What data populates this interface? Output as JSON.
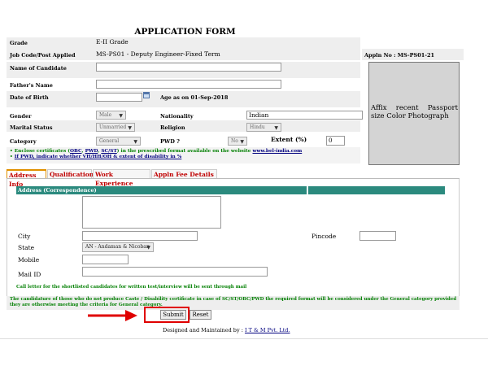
{
  "title": "APPLICATION FORM",
  "grade": {
    "label": "Grade",
    "value": "E-II Grade"
  },
  "job": {
    "label": "Job Code/Post Applied",
    "value": "MS-PS01 - Deputy Engineer-Fixed Term"
  },
  "appln_no": "Appln No : MS-PS01-21",
  "name": {
    "label": "Name of Candidate",
    "value": ""
  },
  "father": {
    "label": "Father's Name",
    "value": ""
  },
  "dob": {
    "label": "Date of Birth",
    "value": "",
    "age_label": "Age as on 01-Sep-2018"
  },
  "gender": {
    "label": "Gender",
    "value": "Male"
  },
  "nationality": {
    "label": "Nationality",
    "value": "Indian"
  },
  "marital": {
    "label": "Marital Status",
    "value": "Unmarried"
  },
  "religion": {
    "label": "Religion",
    "value": "Hindu"
  },
  "category": {
    "label": "Category",
    "value": "General"
  },
  "pwd": {
    "label": "PWD ?",
    "value": "No"
  },
  "extent": {
    "label": "Extent (%)",
    "value": "0"
  },
  "photo_text": "Affix recent Passport size Color Photograph",
  "notes": {
    "line1_prefix": "• Enclose certificates (",
    "obc": "OBC",
    "sep1": ", ",
    "pwd": "PWD",
    "sep2": ", ",
    "scst": "SC/ST",
    "line1_mid": ") in the prescribed format available on the website ",
    "website": "www.bel-india.com",
    "line2_prefix": "• ",
    "line2_link": "If PWD, indicate whether VH/HH/OH & extent of disability in %"
  },
  "tabs": [
    "Address Info",
    "Qualification",
    "Work Experience",
    "Appln Fee Details"
  ],
  "address": {
    "header": "Address (Correspondence)",
    "city_label": "City",
    "pincode_label": "Pincode",
    "state_label": "State",
    "state_value": "AN - Andaman & Nicobar",
    "mobile_label": "Mobile",
    "mail_label": "Mail ID"
  },
  "call_letter": "Call letter for the shortlisted candidates for written test/interview will be sent through mail",
  "general_note": "The candidature of those who do not produce Caste / Disability certificate in case of SC/ST/OBC/PWD the required format will be considered under the General category provided they are otherwise meeting the criteria for General category.",
  "buttons": {
    "submit": "Submit",
    "reset": "Reset"
  },
  "footer": {
    "text": "Designed and Maintained by : ",
    "link": "I T & M Pvt. Ltd."
  },
  "colors": {
    "teal": "#2b8a7e",
    "green_note": "#007f00",
    "tab_red": "#c00000",
    "highlight": "#e00000"
  }
}
